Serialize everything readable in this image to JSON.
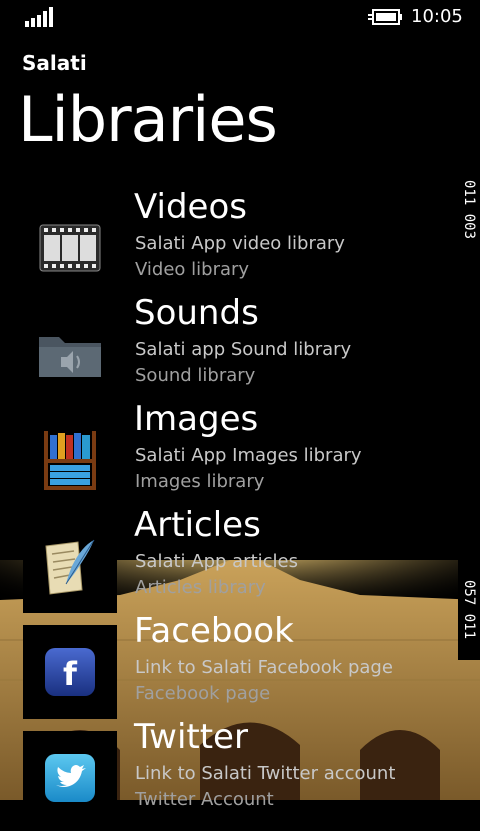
{
  "status": {
    "time": "10:05",
    "signal_icon": "signal-bars-icon",
    "battery_icon": "battery-charging-icon"
  },
  "header": {
    "app_title": "Salati",
    "page_title": "Libraries"
  },
  "side_codes": {
    "top": "011 003",
    "bottom": "057 011"
  },
  "items": [
    {
      "title": "Videos",
      "subtitle": "Salati App video library",
      "detail": "Video library",
      "icon": "film-icon"
    },
    {
      "title": "Sounds",
      "subtitle": "Salati app Sound library",
      "detail": "Sound library",
      "icon": "sound-folder-icon"
    },
    {
      "title": "Images",
      "subtitle": "Salati App Images library",
      "detail": "Images library",
      "icon": "bookshelf-icon"
    },
    {
      "title": "Articles",
      "subtitle": "Salati App articles",
      "detail": "Articles library",
      "icon": "quill-paper-icon"
    },
    {
      "title": "Facebook",
      "subtitle": "Link to Salati Facebook page",
      "detail": "Facebook page",
      "icon": "facebook-icon"
    },
    {
      "title": "Twitter",
      "subtitle": "Link to Salati Twitter account",
      "detail": "Twitter Account",
      "icon": "twitter-icon"
    }
  ]
}
